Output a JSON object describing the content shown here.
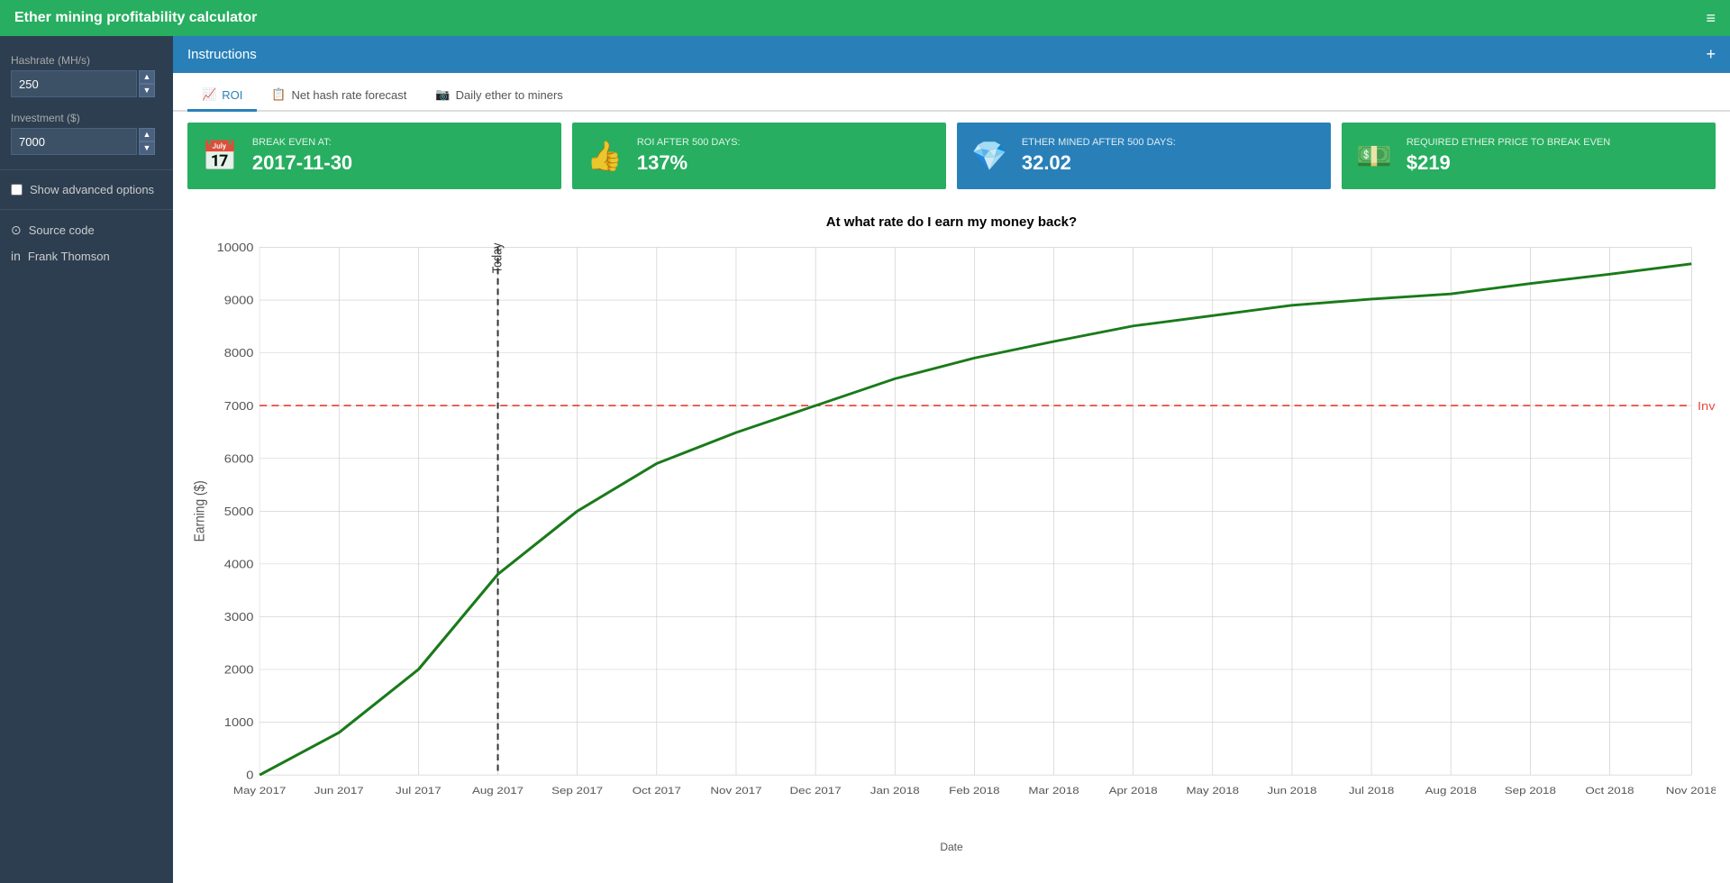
{
  "navbar": {
    "title": "Ether mining profitability calculator",
    "menu_icon": "≡"
  },
  "sidebar": {
    "hashrate_label": "Hashrate (MH/s)",
    "hashrate_value": "250",
    "investment_label": "Investment ($)",
    "investment_value": "7000",
    "advanced_options_label": "Show advanced options",
    "source_code_label": "Source code",
    "linkedin_label": "Frank Thomson"
  },
  "instructions": {
    "title": "Instructions",
    "plus_icon": "+"
  },
  "tabs": [
    {
      "id": "roi",
      "label": "ROI",
      "icon": "📈",
      "active": true
    },
    {
      "id": "nethash",
      "label": "Net hash rate forecast",
      "icon": "📋",
      "active": false
    },
    {
      "id": "daily",
      "label": "Daily ether to miners",
      "icon": "📷",
      "active": false
    }
  ],
  "stats": [
    {
      "color": "green",
      "icon": "📅",
      "label": "BREAK EVEN AT:",
      "value": "2017-11-30"
    },
    {
      "color": "green",
      "icon": "👍",
      "label": "ROI AFTER 500 DAYS:",
      "value": "137%"
    },
    {
      "color": "blue",
      "icon": "💎",
      "label": "ETHER MINED AFTER 500 DAYS:",
      "value": "32.02"
    },
    {
      "color": "green",
      "icon": "💵",
      "label": "REQUIRED ETHER PRICE TO BREAK EVEN",
      "value": "$219"
    }
  ],
  "chart": {
    "title": "At what rate do I earn my money back?",
    "x_label": "Date",
    "y_label": "Earning ($)",
    "investment_line_label": "Investment",
    "investment_value": 7000,
    "y_max": 10000,
    "x_labels": [
      "May 2017",
      "Jun 2017",
      "Jul 2017",
      "Aug 2017",
      "Sep 2017",
      "Oct 2017",
      "Nov 2017",
      "Dec 2017",
      "Jan 2018",
      "Feb 2018",
      "Mar 2018",
      "Apr 2018",
      "May 2018",
      "Jun 2018",
      "Jul 2018",
      "Aug 2018",
      "Sep 2018",
      "Oct 2018",
      "Nov 2018"
    ],
    "y_labels": [
      "0",
      "1000",
      "2000",
      "3000",
      "4000",
      "5000",
      "6000",
      "7000",
      "8000",
      "9000",
      "10000"
    ],
    "today_label": "Today"
  }
}
